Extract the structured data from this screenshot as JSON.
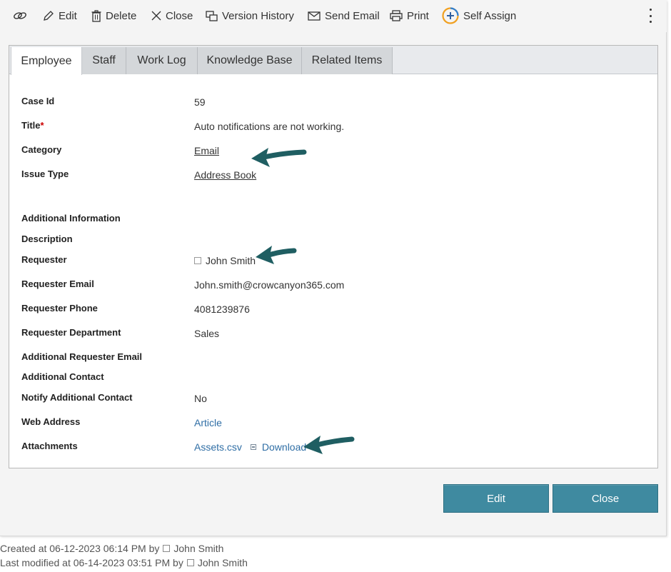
{
  "toolbar": {
    "edit": "Edit",
    "delete": "Delete",
    "close": "Close",
    "version_history": "Version History",
    "send_email": "Send Email",
    "print": "Print",
    "self_assign": "Self Assign"
  },
  "tabs": [
    "Employee",
    "Staff",
    "Work Log",
    "Knowledge Base",
    "Related Items"
  ],
  "fields": {
    "case_id": {
      "label": "Case Id",
      "value": "59"
    },
    "title": {
      "label": "Title",
      "required_mark": "*",
      "value": "Auto notifications are not working."
    },
    "category": {
      "label": "Category",
      "value": "Email"
    },
    "issue_type": {
      "label": "Issue Type",
      "value": "Address Book"
    },
    "additional_information": {
      "label": "Additional Information"
    },
    "description": {
      "label": "Description"
    },
    "requester": {
      "label": "Requester",
      "value": "John Smith"
    },
    "requester_email": {
      "label": "Requester Email",
      "value": "John.smith@crowcanyon365.com"
    },
    "requester_phone": {
      "label": "Requester Phone",
      "value": "4081239876"
    },
    "requester_department": {
      "label": "Requester Department",
      "value": "Sales"
    },
    "additional_requester_email": {
      "label": "Additional Requester Email"
    },
    "additional_contact": {
      "label": "Additional Contact"
    },
    "notify_additional_contact": {
      "label": "Notify Additional Contact",
      "value": "No"
    },
    "web_address": {
      "label": "Web Address",
      "value": "Article"
    },
    "attachments": {
      "label": "Attachments",
      "file": "Assets.csv",
      "download": "Download"
    }
  },
  "buttons": {
    "edit": "Edit",
    "close": "Close"
  },
  "footer": {
    "created_prefix": "Created at 06-12-2023 06:14 PM by",
    "created_by": "John Smith",
    "modified_prefix": "Last modified at 06-14-2023 03:51 PM by",
    "modified_by": "John Smith"
  },
  "colors": {
    "button_bg": "#3f8aa0",
    "arrow": "#1f5e62",
    "link": "#2f6ea5",
    "required": "#cc0000"
  },
  "icons": [
    "link-icon",
    "pencil-icon",
    "trash-icon",
    "close-icon",
    "version-history-icon",
    "envelope-icon",
    "printer-icon",
    "self-assign-icon",
    "more-vertical-icon"
  ]
}
